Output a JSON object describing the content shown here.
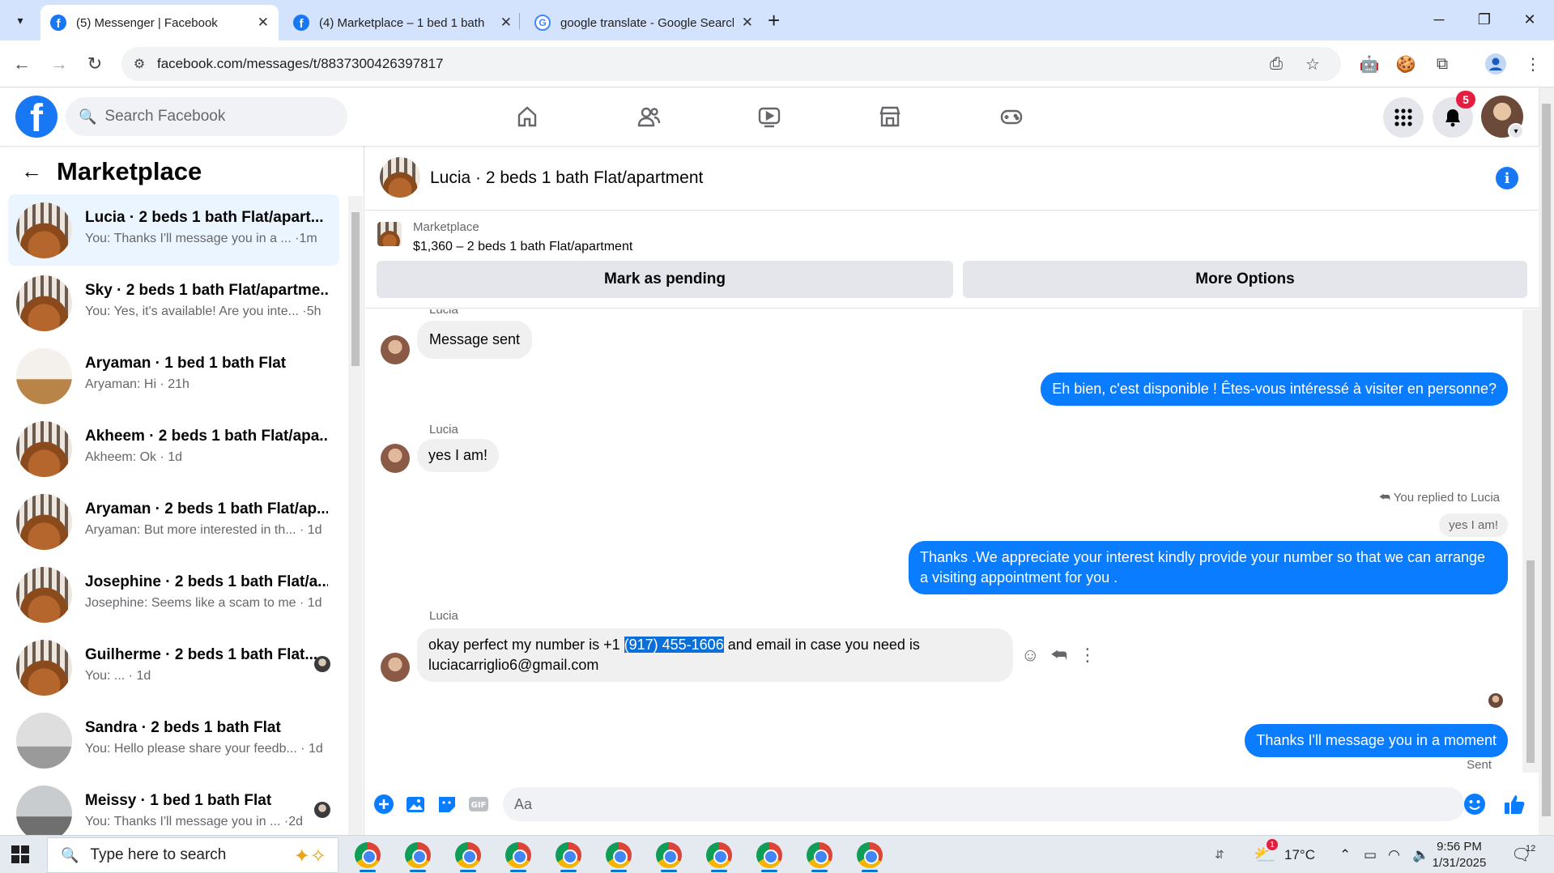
{
  "browser": {
    "tabs": [
      {
        "title": "(5) Messenger | Facebook",
        "active": true
      },
      {
        "title": "(4) Marketplace – 1 bed 1 bath",
        "active": false
      },
      {
        "title": "google translate - Google Search",
        "active": false
      }
    ],
    "url": "facebook.com/messages/t/8837300426397817"
  },
  "fb": {
    "search_placeholder": "Search Facebook",
    "notification_count": "5"
  },
  "sidebar": {
    "title": "Marketplace",
    "conversations": [
      {
        "name": "Lucia · 2 beds 1 bath Flat/apart...",
        "preview": "You: Thanks I'll message you in a ... ·1m",
        "active": true
      },
      {
        "name": "Sky · 2 beds 1 bath Flat/apartme...",
        "preview": "You: Yes, it's available! Are you inte... ·5h"
      },
      {
        "name": "Aryaman · 1 bed 1 bath Flat",
        "preview": "Aryaman: Hi · 21h"
      },
      {
        "name": "Akheem · 2 beds 1 bath Flat/apa...",
        "preview": "Akheem: Ok · 1d"
      },
      {
        "name": "Aryaman · 2 beds 1 bath Flat/ap...",
        "preview": "Aryaman: But more interested in th... · 1d"
      },
      {
        "name": "Josephine · 2 beds 1 bath Flat/a...",
        "preview": "Josephine: Seems like a scam to me · 1d"
      },
      {
        "name": "Guilherme · 2 beds 1 bath Flat...",
        "preview": "You: ... · 1d"
      },
      {
        "name": "Sandra · 2 beds 1 bath Flat",
        "preview": "You: Hello please share your feedb... · 1d"
      },
      {
        "name": "Meissy · 1 bed 1 bath Flat",
        "preview": "You: Thanks I'll message you in ... ·2d"
      }
    ]
  },
  "chat": {
    "title": "Lucia · 2 beds 1 bath Flat/apartment",
    "listing": {
      "source": "Marketplace",
      "price_line": "$1,360 – 2 beds 1 bath Flat/apartment"
    },
    "buttons": {
      "mark_pending": "Mark as pending",
      "more_options": "More Options"
    },
    "messages": {
      "sender_top": "Lucia",
      "msg1": "Message sent",
      "out1": "Eh bien, c'est disponible ! Êtes-vous intéressé à visiter en personne?",
      "sender2": "Lucia",
      "msg2": "yes I am!",
      "replied_label": "You replied to Lucia",
      "quoted": "yes I am!",
      "out2": "Thanks .We appreciate your interest kindly provide your number so that we can arrange a visiting appointment for you .",
      "sender3": "Lucia",
      "msg3_before": "okay perfect my number is +1 ",
      "msg3_phone": "(917) 455-1606",
      "msg3_after": " and email in case you need is",
      "msg3_email": "luciacarriglio6@gmail.com",
      "out3": "Thanks I'll message you in a moment",
      "status": "Sent"
    },
    "composer_placeholder": "Aa"
  },
  "taskbar": {
    "search_placeholder": "Type here to search",
    "weather": "17°C",
    "weather_badge": "1",
    "time": "9:56 PM",
    "date": "1/31/2025",
    "notif_count": "12"
  },
  "colors": {
    "fb_blue": "#1877f2",
    "messenger_blue": "#0a7cff",
    "active_row": "#ebf5ff",
    "tabbar": "#d3e3fd"
  }
}
